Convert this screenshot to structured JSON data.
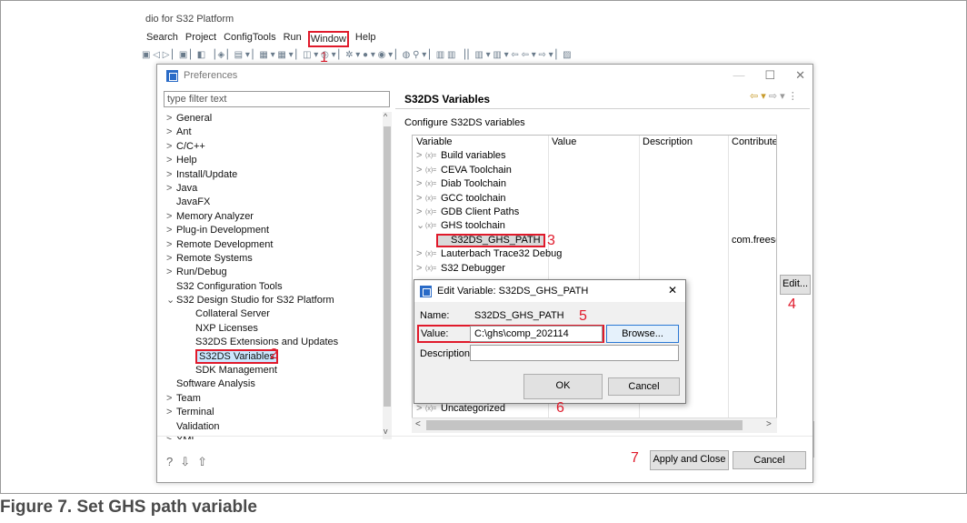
{
  "ide": {
    "title": "dio for S32 Platform",
    "menus": [
      "Search",
      "Project",
      "ConfigTools",
      "Run",
      "Window",
      "Help"
    ]
  },
  "preferences": {
    "title": "Preferences",
    "filter_placeholder": "type filter text",
    "tree": [
      {
        "label": "General",
        "arrow": ">"
      },
      {
        "label": "Ant",
        "arrow": ">"
      },
      {
        "label": "C/C++",
        "arrow": ">"
      },
      {
        "label": "Help",
        "arrow": ">"
      },
      {
        "label": "Install/Update",
        "arrow": ">"
      },
      {
        "label": "Java",
        "arrow": ">"
      },
      {
        "label": "JavaFX",
        "arrow": ""
      },
      {
        "label": "Memory Analyzer",
        "arrow": ">"
      },
      {
        "label": "Plug-in Development",
        "arrow": ">"
      },
      {
        "label": "Remote Development",
        "arrow": ">"
      },
      {
        "label": "Remote Systems",
        "arrow": ">"
      },
      {
        "label": "Run/Debug",
        "arrow": ">"
      },
      {
        "label": "S32 Configuration Tools",
        "arrow": ""
      },
      {
        "label": "S32 Design Studio for S32 Platform",
        "arrow": "v"
      },
      {
        "label": "Collateral Server",
        "arrow": "",
        "indent": true
      },
      {
        "label": "NXP Licenses",
        "arrow": "",
        "indent": true
      },
      {
        "label": "S32DS Extensions and Updates",
        "arrow": "",
        "indent": true
      },
      {
        "label": "S32DS Variables",
        "arrow": "",
        "indent": true,
        "selected": true
      },
      {
        "label": "SDK Management",
        "arrow": "",
        "indent": true
      },
      {
        "label": "Software Analysis",
        "arrow": ""
      },
      {
        "label": "Team",
        "arrow": ">"
      },
      {
        "label": "Terminal",
        "arrow": ">"
      },
      {
        "label": "Validation",
        "arrow": ""
      },
      {
        "label": "XML",
        "arrow": ">"
      }
    ],
    "page_title": "S32DS Variables",
    "page_desc": "Configure S32DS variables",
    "columns": [
      "Variable",
      "Value",
      "Description",
      "Contribute"
    ],
    "rows": [
      {
        "label": "Build variables",
        "arrow": ">",
        "contrib": ""
      },
      {
        "label": "CEVA Toolchain",
        "arrow": ">",
        "contrib": ""
      },
      {
        "label": "Diab Toolchain",
        "arrow": ">",
        "contrib": ""
      },
      {
        "label": "GCC toolchain",
        "arrow": ">",
        "contrib": ""
      },
      {
        "label": "GDB Client Paths",
        "arrow": ">",
        "contrib": ""
      },
      {
        "label": "GHS toolchain",
        "arrow": "v",
        "contrib": ""
      },
      {
        "label": "S32DS_GHS_PATH",
        "arrow": "",
        "contrib": "com.freesc",
        "child": true
      },
      {
        "label": "Lauterbach Trace32 Debug",
        "arrow": ">",
        "contrib": ""
      },
      {
        "label": "S32 Debugger",
        "arrow": ">",
        "contrib": ""
      }
    ],
    "last_row": "Uncategorized",
    "var_prefix": "(x)=",
    "edit_button": "Edit...",
    "apply_close": "Apply and Close",
    "cancel": "Cancel"
  },
  "edit_dialog": {
    "title": "Edit Variable: S32DS_GHS_PATH",
    "name_label": "Name:",
    "name_value": "S32DS_GHS_PATH",
    "value_label": "Value:",
    "value_value": "C:\\ghs\\comp_202114",
    "browse": "Browse...",
    "desc_label": "Description:",
    "ok": "OK",
    "cancel": "Cancel"
  },
  "steps": [
    "1",
    "2",
    "3",
    "4",
    "5",
    "6",
    "7"
  ],
  "caption": "Figure 7.  Set GHS path variable",
  "colors": {
    "annotation": "#e01a2b",
    "selection": "#cce8ff",
    "caption": "#4a4a4a"
  }
}
